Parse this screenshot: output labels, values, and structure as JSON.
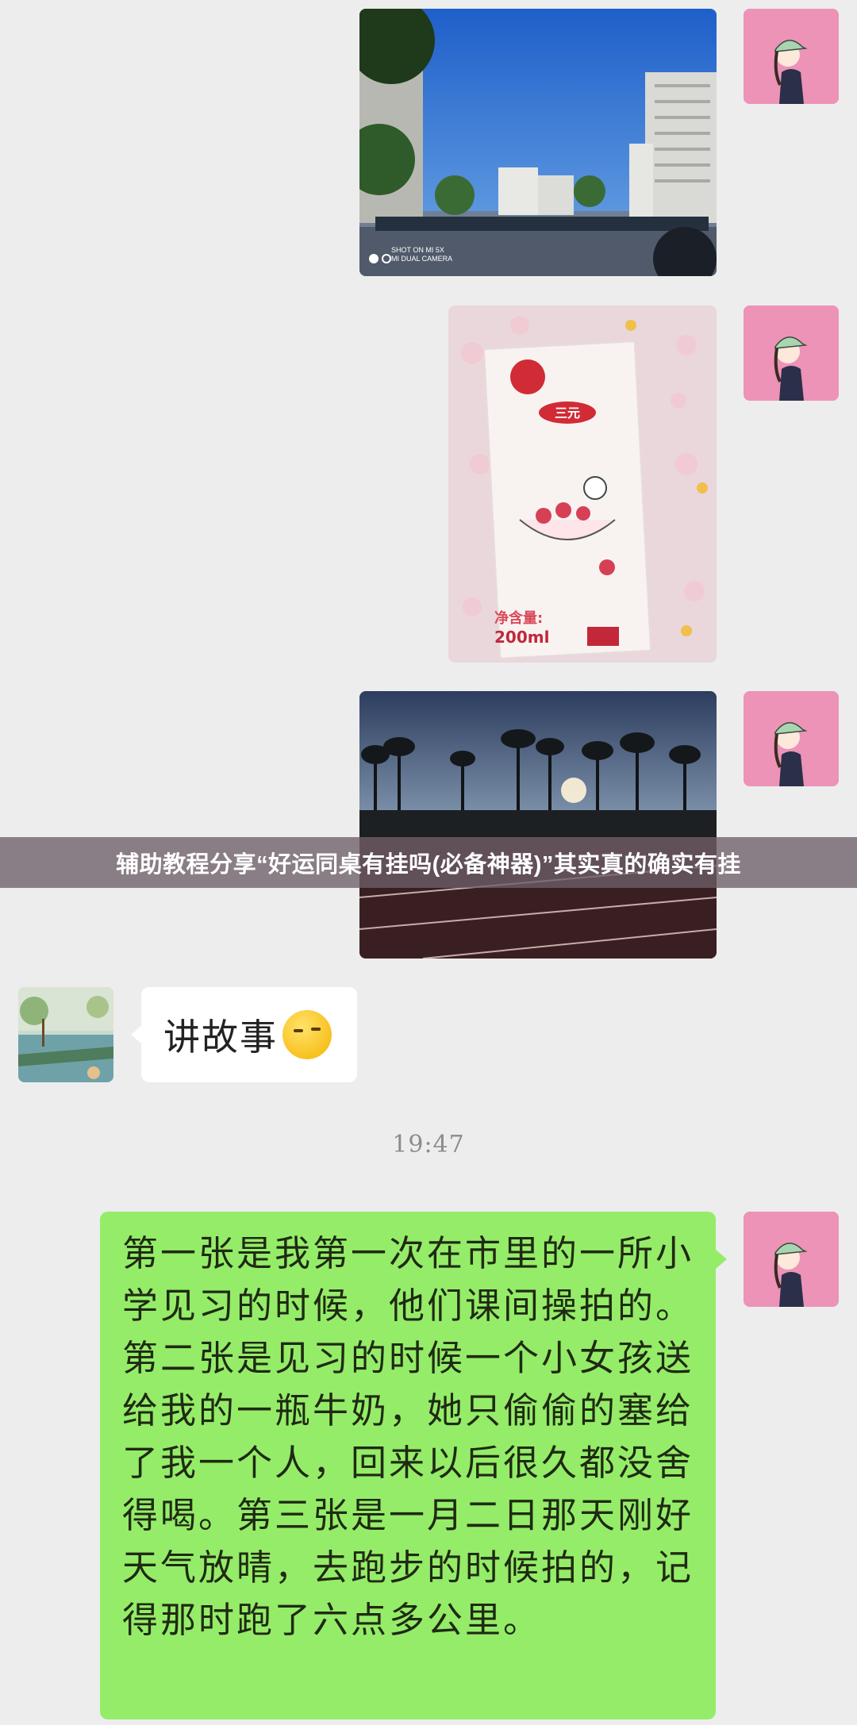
{
  "messages": {
    "friend_text": "讲故事",
    "friend_emoji": "smirk-emoji",
    "timestamp": "19:47",
    "long_text": "第一张是我第一次在市里的一所小学见习的时候，他们课间操拍的。第二张是见习的时候一个小女孩送给我的一瓶牛奶，她只偷偷的塞给了我一个人，回来以后很久都没舍得喝。第三张是一月二日那天刚好天气放晴，去跑步的时候拍的，记得那时跑了六点多公里。"
  },
  "photo1": {
    "watermark_line1": "SHOT ON MI 5X",
    "watermark_line2": "MI DUAL CAMERA"
  },
  "photo2": {
    "milk_volume": "200ml",
    "net_label": "净含量:",
    "brand": "三元"
  },
  "banner": {
    "text": "辅助教程分享“好运同桌有挂吗(必备神器)”其实真的确实有挂"
  },
  "colors": {
    "self_bubble": "#95ec69",
    "friend_bubble": "#ffffff",
    "background": "#ededed",
    "avatar_pink": "#ec93b7"
  }
}
